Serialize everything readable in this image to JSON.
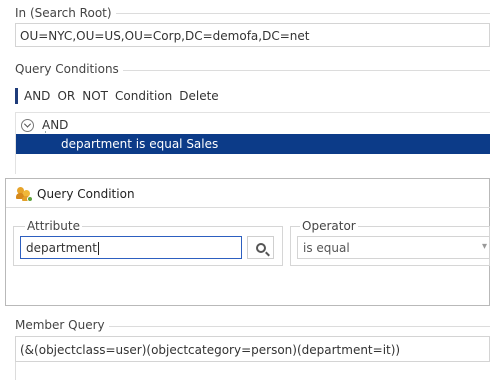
{
  "search_root": {
    "label": "In (Search Root)",
    "value": "OU=NYC,OU=US,OU=Corp,DC=demofa,DC=net"
  },
  "query_conditions": {
    "label": "Query Conditions",
    "toolbar": [
      "AND",
      "OR",
      "NOT",
      "Condition",
      "Delete"
    ],
    "tree": {
      "root": "AND",
      "selected_condition": "department is equal Sales"
    }
  },
  "dialog": {
    "title": "Query Condition",
    "attribute": {
      "label": "Attribute",
      "value": "department"
    },
    "operator": {
      "label": "Operator",
      "value": "is equal"
    }
  },
  "member_query": {
    "label": "Member Query",
    "value": "(&(objectclass=user)(objectcategory=person)(department=it))"
  }
}
